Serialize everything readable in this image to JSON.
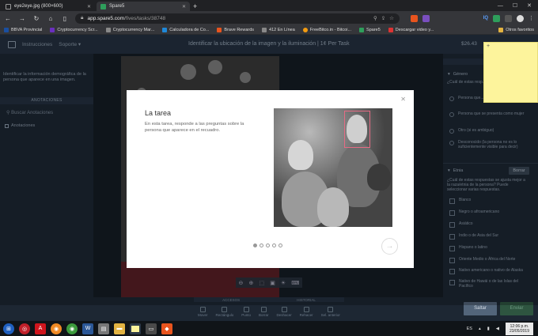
{
  "browser": {
    "tabs": [
      {
        "label": "eye2eye.jpg (800×600)",
        "active": false
      },
      {
        "label": "Spare5",
        "active": true
      }
    ],
    "url_host": "app.spare5.com",
    "url_path": "/fives/tasks/38748",
    "bookmarks": [
      "BBVA Provincial",
      "Cryptocurrency Scr...",
      "Cryptocurrency Mar...",
      "Calculadora de Co...",
      "Brave Rewards",
      "412 En Línea",
      "FreeBitco.in - Bitcoi...",
      "Spare5",
      "Descargar video y..."
    ],
    "bookmarks_other": "Otros favoritos",
    "ext_iq": "IQ"
  },
  "header": {
    "instrucciones": "Instrucciones",
    "soporte": "Soporte",
    "title": "Identificar la ubicación de la imagen y la iluminación | 1¢ Per Task",
    "price": "$26.43"
  },
  "left": {
    "description": "Identificar la información demográfica de la persona que aparece en una imagen.",
    "annotations_header": "ANOTACIONES",
    "search_placeholder": "Buscar Anotaciones",
    "annotations_label": "Anotaciones"
  },
  "right": {
    "gender_section": "Género",
    "gender_question": "¿Cuál de estas resp... el género/sexo de l...",
    "gender_options": [
      "Persona que... varón",
      "Persona que se presenta como mujer",
      "Otro (si es ambiguo)",
      "Desconocido (la persona no es lo suficientemente visible para decir)"
    ],
    "etnia_section": "Etnia",
    "clear_label": "Borrar",
    "etnia_question": "¿Cuál de estas respuestas se ajusta mejor a la raza/etnia de la persona? Puede seleccionar varias respuestas.",
    "etnia_options": [
      "Blanco",
      "Negro o afroamericano",
      "Asiático",
      "Indio o de Asia del Sur",
      "Hispano o latino",
      "Oriente Medio o África del Norte",
      "Nativo americano o nativo de Alaska",
      "Nativo de Hawái o de las Islas del Pacífico"
    ]
  },
  "bottom": {
    "tabs": [
      "ACCESOS",
      "HISTORIAL"
    ],
    "tools": [
      "Mover",
      "Rectángulo",
      "Punto",
      "Borrar",
      "Deshacer",
      "Rehacer",
      "Sel. anterior"
    ],
    "omit_label": "Saltar",
    "send_label": "Enviar"
  },
  "modal": {
    "title": "La tarea",
    "body": "En esta tarea, responde a las preguntas sobre la persona que aparece en el recuadro.",
    "slides_total": 5,
    "slide_current": 1
  },
  "taskbar": {
    "lang": "ES",
    "time": "12:06 p.m.",
    "date": "23/05/2019"
  }
}
